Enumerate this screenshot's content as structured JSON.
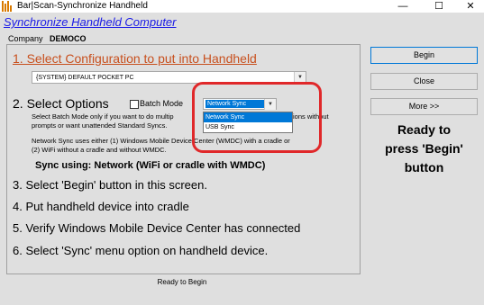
{
  "window": {
    "title": "Bar|Scan-Synchronize Handheld",
    "controls": {
      "minimize": "—",
      "maximize": "☐",
      "close": "✕"
    }
  },
  "header": {
    "link": "Synchronize Handheld Computer"
  },
  "company": {
    "label": "Company",
    "value": "DEMOCO"
  },
  "step1": {
    "title": "1. Select Configuration to put into Handheld",
    "selected": "{SYSTEM} DEFAULT POCKET PC"
  },
  "step2": {
    "title": "2. Select Options",
    "batch_label": "Batch Mode",
    "sync_selected": "Network Sync",
    "sync_options": [
      "Network Sync",
      "USB Sync"
    ],
    "batch_note_1": "Select Batch Mode only if you want to do multip",
    "batch_note_1b": "ions without",
    "batch_note_2": "prompts or want unattended Standard Syncs.",
    "wmdc_note_1": "Network Sync uses either (1) Windows Mobile Device Center (WMDC)  with a cradle or",
    "wmdc_note_2": "(2) WiFi without a cradle and without WMDC.",
    "sync_using": "Sync using: Network (WiFi or cradle with WMDC)"
  },
  "steps": {
    "s3": "3. Select 'Begin' button in this screen.",
    "s4": "4. Put handheld device into cradle",
    "s5": "5. Verify Windows Mobile Device Center has connected",
    "s6": "6. Select 'Sync' menu option on handheld device."
  },
  "buttons": {
    "begin": "Begin",
    "close": "Close",
    "more": "More >>"
  },
  "ready_message": {
    "line1": "Ready to",
    "line2": "press 'Begin'",
    "line3": "button"
  },
  "status": "Ready to Begin",
  "colors": {
    "accent": "#0078d7",
    "highlight": "#e0282a",
    "step1": "#c8501e",
    "link": "#1a1ae6"
  }
}
